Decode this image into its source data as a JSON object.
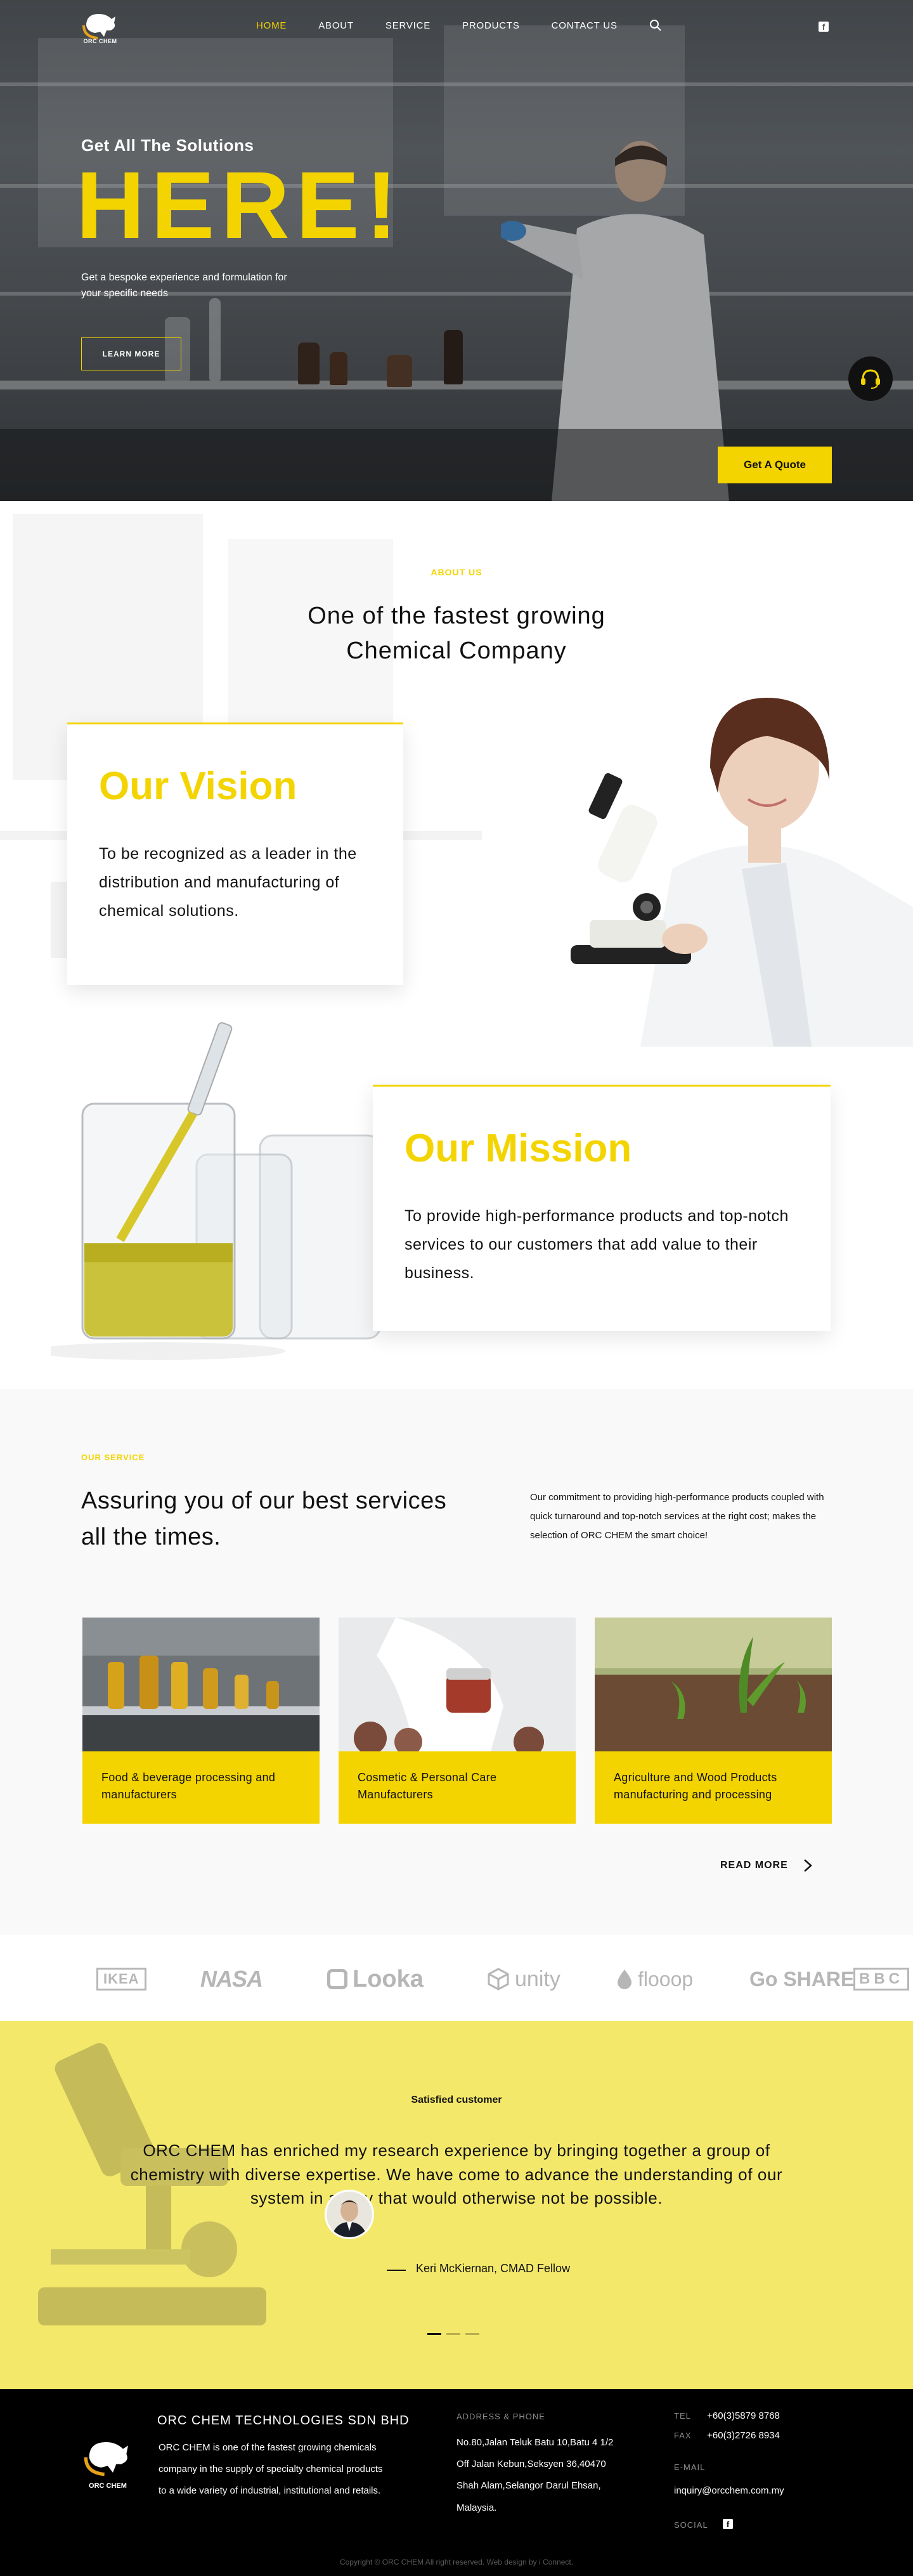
{
  "nav": {
    "logo_text": "ORC CHEM",
    "links": [
      "HOME",
      "ABOUT",
      "SERVICE",
      "PRODUCTS",
      "CONTACT US"
    ],
    "active": "HOME",
    "search_icon": "search-icon",
    "social_icon": "facebook-icon"
  },
  "hero": {
    "eyebrow": "Get All The Solutions",
    "title": "HERE!",
    "subtitle": "Get a bespoke experience and formulation for your specific needs",
    "learn_more": "LEARN MORE",
    "quote_button": "Get A Quote",
    "support_icon": "headset-icon"
  },
  "about": {
    "eyebrow": "ABOUT US",
    "title_line1": "One of the fastest growing",
    "title_line2": "Chemical Company",
    "vision_title": "Our Vision",
    "vision_text": "To be recognized as a leader in the distribution and manufacturing of chemical solutions.",
    "mission_title": "Our Mission",
    "mission_text": "To provide high-performance products and top-notch services to our customers that add value to their business."
  },
  "service": {
    "eyebrow": "OUR SERVICE",
    "title": "Assuring you of our best services all the times.",
    "description": "Our commitment to providing high-performance products coupled with quick turnaround and top-notch services at the right cost; makes the selection of ORC CHEM the smart choice!",
    "cards": [
      {
        "label": "Food & beverage processing and manufacturers"
      },
      {
        "label": "Cosmetic & Personal Care Manufacturers"
      },
      {
        "label": "Agriculture and Wood Products manufacturing and processing"
      }
    ],
    "read_more": "READ MORE"
  },
  "brands": [
    "IKEA",
    "NASA",
    "Looka",
    "unity",
    "flooop",
    "Go SHARE",
    "BBC"
  ],
  "testimonial": {
    "eyebrow": "Satisfied customer",
    "quote": "ORC CHEM has enriched my research experience by bringing together a group of chemistry with diverse expertise. We have come to advance the understanding of our system in a way that would otherwise not be possible.",
    "author": "Keri McKiernan, CMAD Fellow",
    "slides": 3,
    "active_slide": 1
  },
  "footer": {
    "company": "ORC CHEM TECHNOLOGIES SDN BHD",
    "about": "ORC CHEM is one of the fastest growing chemicals company in the supply of specialty chemical products  to a wide variety of industrial, institutional and retails.",
    "address_heading": "ADDRESS & PHONE",
    "address": "No.80,Jalan Teluk Batu 10,Batu 4 1/2 Off Jalan Kebun,Seksyen 36,40470 Shah Alam,Selangor Darul Ehsan, Malaysia.",
    "tel_label": "TEL",
    "tel": "+60(3)5879 8768",
    "fax_label": "FAX",
    "fax": "+60(3)2726 8934",
    "email_heading": "E-MAIL",
    "email": "inquiry@orcchem.com.my",
    "social_heading": "SOCIAL",
    "copyright": "Copyright © ORC CHEM All right reserved. Web design by i Connect."
  },
  "colors": {
    "accent": "#f3d400",
    "testimonial_bg": "#f4e86a",
    "footer_bg": "#000000"
  }
}
